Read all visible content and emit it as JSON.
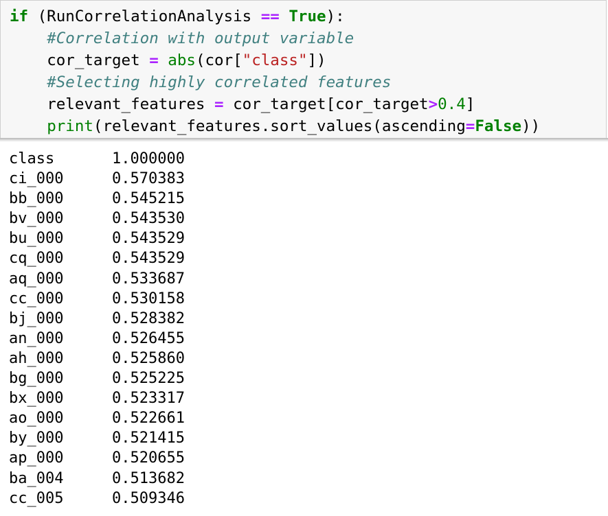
{
  "code_cell": {
    "line1": {
      "kw_if": "if",
      "open": " (RunCorrelationAnalysis ",
      "op_eq": "==",
      "space": " ",
      "kw_true": "True",
      "close": "):"
    },
    "line2": {
      "indent": "    ",
      "comment": "#Correlation with output variable"
    },
    "line3": {
      "indent": "    ",
      "lhs": "cor_target ",
      "op_assign": "=",
      "space": " ",
      "fn_abs": "abs",
      "mid": "(cor[",
      "string": "\"class\"",
      "end": "])"
    },
    "line4": {
      "indent": "    ",
      "comment": "#Selecting highly correlated features"
    },
    "line5": {
      "indent": "    ",
      "lhs": "relevant_features ",
      "op_assign": "=",
      "mid": " cor_target[cor_target",
      "op_gt": ">",
      "number": "0.4",
      "end": "]"
    },
    "line6": {
      "indent": "    ",
      "fn_print": "print",
      "mid": "(relevant_features.sort_values(ascending",
      "op_assign": "=",
      "kw_false": "False",
      "end": "))"
    }
  },
  "output": {
    "rows": [
      {
        "name": "class",
        "value": "1.000000"
      },
      {
        "name": "ci_000",
        "value": "0.570383"
      },
      {
        "name": "bb_000",
        "value": "0.545215"
      },
      {
        "name": "bv_000",
        "value": "0.543530"
      },
      {
        "name": "bu_000",
        "value": "0.543529"
      },
      {
        "name": "cq_000",
        "value": "0.543529"
      },
      {
        "name": "aq_000",
        "value": "0.533687"
      },
      {
        "name": "cc_000",
        "value": "0.530158"
      },
      {
        "name": "bj_000",
        "value": "0.528382"
      },
      {
        "name": "an_000",
        "value": "0.526455"
      },
      {
        "name": "ah_000",
        "value": "0.525860"
      },
      {
        "name": "bg_000",
        "value": "0.525225"
      },
      {
        "name": "bx_000",
        "value": "0.523317"
      },
      {
        "name": "ao_000",
        "value": "0.522661"
      },
      {
        "name": "by_000",
        "value": "0.521415"
      },
      {
        "name": "ap_000",
        "value": "0.520655"
      },
      {
        "name": "ba_004",
        "value": "0.513682"
      },
      {
        "name": "cc_005",
        "value": "0.509346"
      }
    ]
  },
  "colors": {
    "keyword": "#008000",
    "operator": "#aa22ff",
    "comment": "#408080",
    "string": "#ba2121",
    "cell_background": "#f7f7f7",
    "cell_border": "#cfcfcf"
  }
}
